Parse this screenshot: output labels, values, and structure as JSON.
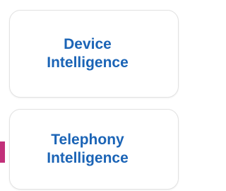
{
  "cards": [
    {
      "label": "Device\nIntelligence"
    },
    {
      "label": "Telephony\nIntelligence"
    }
  ],
  "colors": {
    "label": "#1b64b6",
    "card_border": "#e2e2e2",
    "accent": "#c2307a"
  }
}
